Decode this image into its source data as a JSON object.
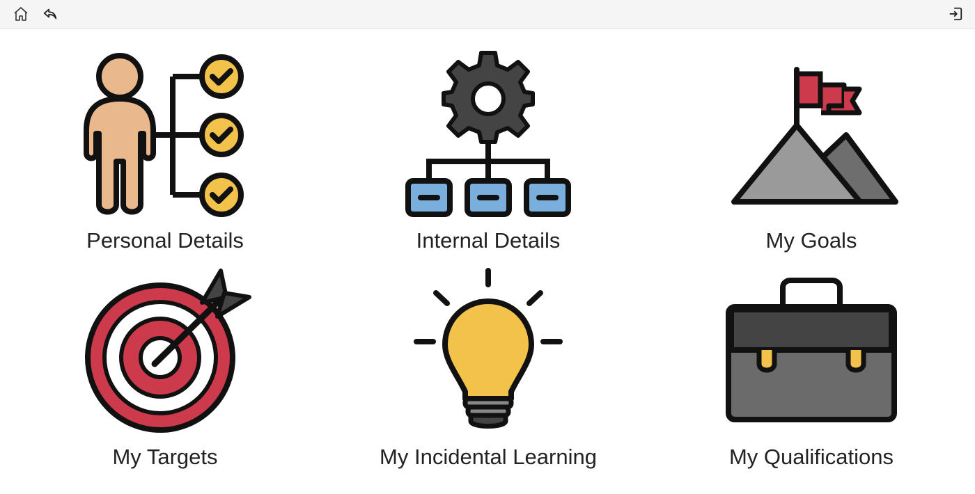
{
  "topbar": {
    "home_icon": "home-icon",
    "back_icon": "back-reply-icon",
    "logout_icon": "logout-icon"
  },
  "tiles": [
    {
      "label": "Personal Details",
      "icon": "person-checklist-icon"
    },
    {
      "label": "Internal Details",
      "icon": "gear-hierarchy-icon"
    },
    {
      "label": "My Goals",
      "icon": "mountain-flag-icon"
    },
    {
      "label": "My Targets",
      "icon": "target-arrow-icon"
    },
    {
      "label": "My Incidental Learning",
      "icon": "lightbulb-icon"
    },
    {
      "label": "My Qualifications",
      "icon": "briefcase-icon"
    }
  ],
  "colors": {
    "outline": "#111111",
    "skin": "#e9b98d",
    "check": "#f2c24b",
    "gear": "#444444",
    "box_blue": "#7aaedd",
    "flag_red": "#cc3a4b",
    "mountain_gray": "#9a9a9a",
    "target_red": "#cc3a4b",
    "bulb_yellow": "#f2c24b",
    "case_gray": "#6b6b6b"
  }
}
